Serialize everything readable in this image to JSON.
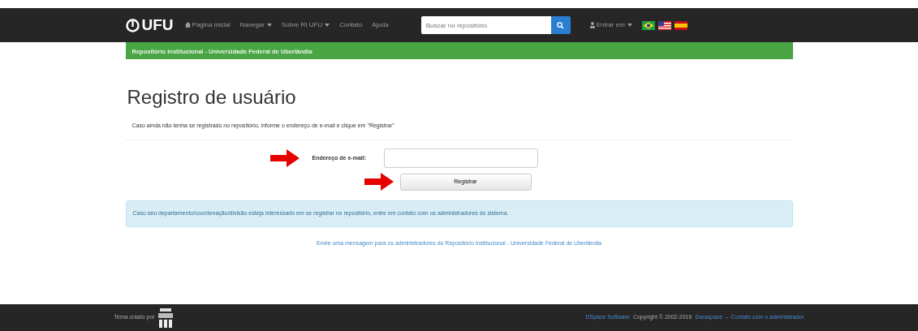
{
  "navbar": {
    "brand": "UFU",
    "items": [
      {
        "label": "Página inicial",
        "kind": "home",
        "dropdown": false
      },
      {
        "label": "Navegar",
        "kind": "link",
        "dropdown": true
      },
      {
        "label": "Sobre RI UFU",
        "kind": "link",
        "dropdown": true
      },
      {
        "label": "Contato",
        "kind": "link",
        "dropdown": false
      },
      {
        "label": "Ajuda",
        "kind": "link",
        "dropdown": false
      }
    ],
    "search": {
      "placeholder": "Buscar no repositório"
    },
    "login": {
      "label": "Entrar em",
      "dropdown": true
    },
    "flags": [
      {
        "kind": "br"
      },
      {
        "kind": "us"
      },
      {
        "kind": "es"
      }
    ]
  },
  "banner": "Repositório Institucional - Universidade Federal de Uberlândia",
  "heading": "Registro de usuário",
  "intro": "Caso ainda não tenha se registrado no repositório, informe o endereço de e-mail e clique em \"Registrar\"",
  "form": {
    "label": "Endereço de e-mail:",
    "button": "Registrar"
  },
  "alert": "Caso seu departamento/coordenação/divisão esteja interessado em se registrar no repositório, entre em contato com os administradores do sistema.",
  "contact_link": "Envie uma mensagem para os administradores do Repositório Institucional - Universidade Federal de Uberlândia",
  "footer": {
    "theme_text": "Tema criado por",
    "links": [
      {
        "label": "DSpace Software",
        "kind": "link"
      },
      {
        "label": "Copyright © 2002-2016",
        "kind": "text"
      },
      {
        "label": "Duraspace",
        "kind": "link"
      },
      {
        "label": "-",
        "kind": "text"
      },
      {
        "label": "Contato com o administrador",
        "kind": "link"
      }
    ]
  }
}
